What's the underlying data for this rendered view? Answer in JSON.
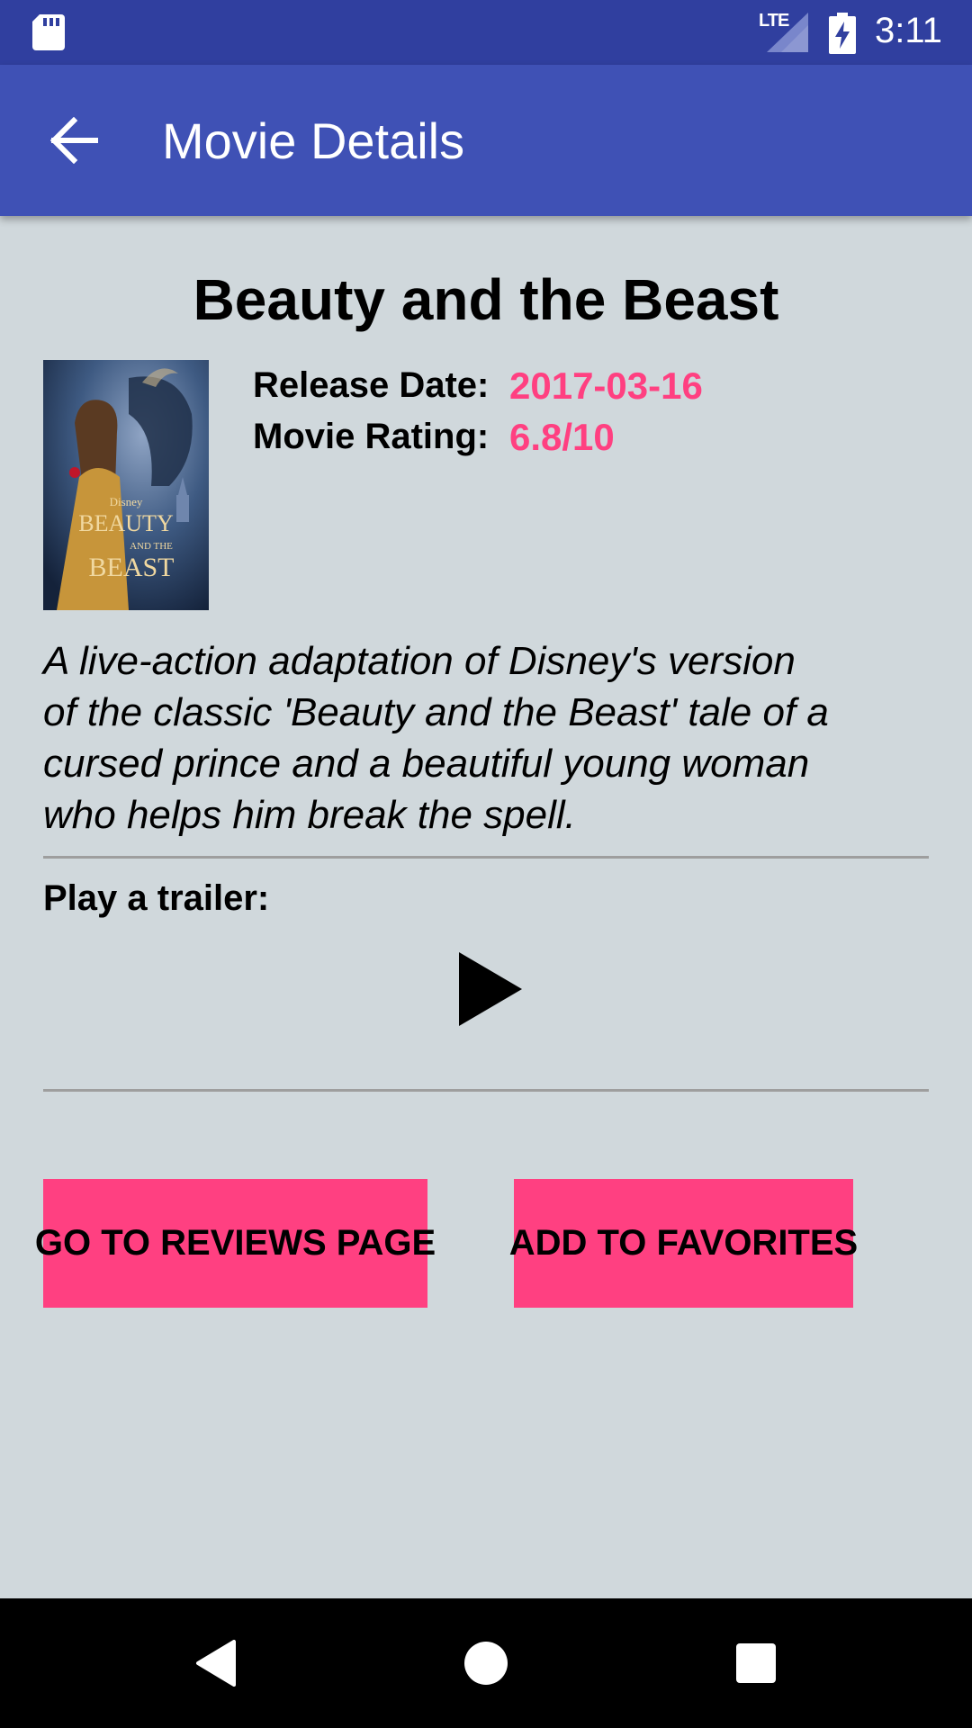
{
  "status_bar": {
    "time": "3:11",
    "network": "LTE",
    "icons": [
      "sd-card-icon",
      "signal-icon",
      "battery-icon"
    ]
  },
  "app_bar": {
    "title": "Movie Details",
    "back_icon": "arrow-back-icon"
  },
  "movie": {
    "title": "Beauty and the Beast",
    "poster": {
      "brand": "Disney",
      "title_line1": "BEAUTY",
      "title_line2": "AND THE",
      "title_line3": "BEAST"
    },
    "release_label": "Release Date:",
    "release_date": "2017-03-16",
    "rating_label": "Movie Rating:",
    "rating": "6.8/10",
    "overview_lines": [
      "A live-action adaptation of Disney's version",
      "of the classic 'Beauty and the Beast' tale of a",
      "cursed prince and a beautiful young woman",
      "who helps him break the spell."
    ]
  },
  "trailer": {
    "label": "Play a trailer:",
    "icon": "play-icon"
  },
  "actions": {
    "reviews_label": "GO TO REVIEWS PAGE",
    "favorites_label": "ADD TO FAVORITES"
  },
  "colors": {
    "status_bar": "#303f9f",
    "app_bar": "#3f51b5",
    "accent": "#ff4081",
    "background": "#d0d8dc"
  },
  "nav_bar": {
    "icons": [
      "nav-back-icon",
      "nav-home-icon",
      "nav-recents-icon"
    ]
  }
}
